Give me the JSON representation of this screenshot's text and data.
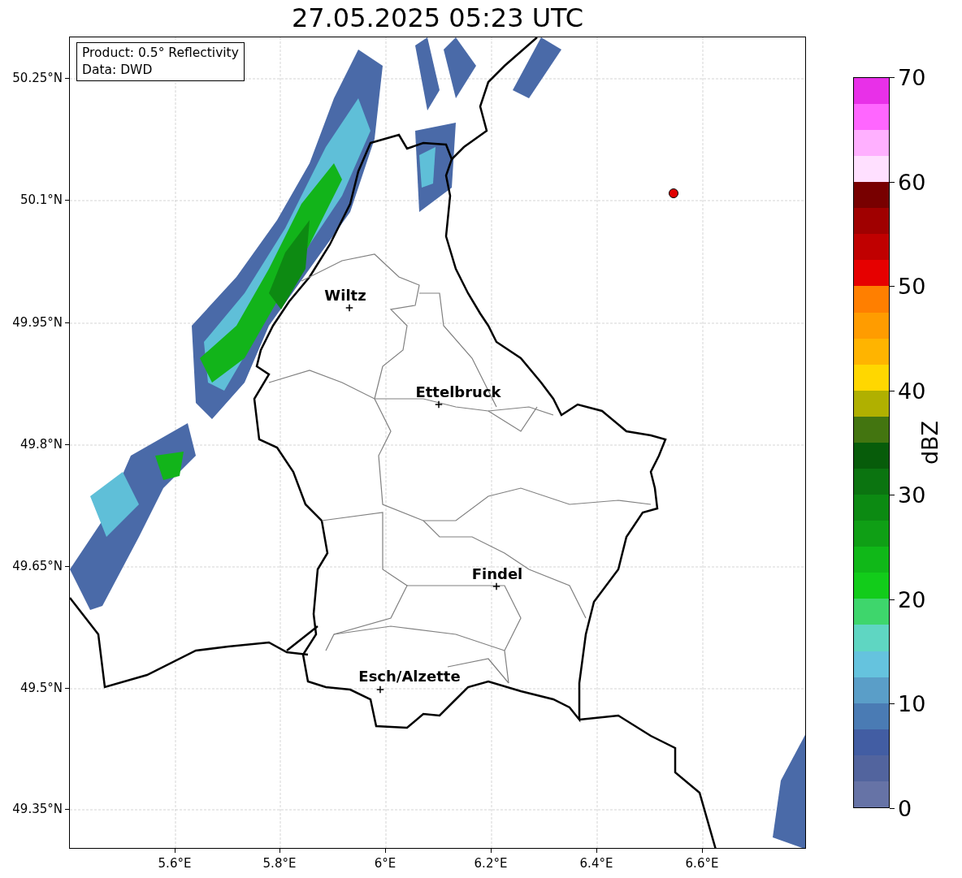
{
  "title": "27.05.2025 05:23 UTC",
  "info_box": [
    "Product: 0.5° Reflectivity",
    "Data: DWD"
  ],
  "y_ticks": [
    "50.25°N",
    "50.1°N",
    "49.95°N",
    "49.8°N",
    "49.65°N",
    "49.5°N",
    "49.35°N"
  ],
  "x_ticks": [
    "5.6°E",
    "5.8°E",
    "6°E",
    "6.2°E",
    "6.4°E",
    "6.6°E"
  ],
  "cities": [
    {
      "name": "Wiltz"
    },
    {
      "name": "Ettelbruck"
    },
    {
      "name": "Findel"
    },
    {
      "name": "Esch/Alzette"
    }
  ],
  "colorbar": {
    "label": "dBZ",
    "ticks": [
      "70",
      "60",
      "50",
      "40",
      "30",
      "20",
      "10",
      "0"
    ],
    "segments": [
      {
        "color": "#6673a6"
      },
      {
        "color": "#52649e"
      },
      {
        "color": "#425da3"
      },
      {
        "color": "#4a7bb4"
      },
      {
        "color": "#5a9ec8"
      },
      {
        "color": "#65c3de"
      },
      {
        "color": "#5fd6c2"
      },
      {
        "color": "#3ed66c"
      },
      {
        "color": "#12cc1a"
      },
      {
        "color": "#10b818"
      },
      {
        "color": "#0f9f15"
      },
      {
        "color": "#0c8a12"
      },
      {
        "color": "#0b7410"
      },
      {
        "color": "#075c0a"
      },
      {
        "color": "#437510"
      },
      {
        "color": "#b0b000"
      },
      {
        "color": "#ffd700"
      },
      {
        "color": "#ffb400"
      },
      {
        "color": "#ff9c00"
      },
      {
        "color": "#ff7f00"
      },
      {
        "color": "#e60000"
      },
      {
        "color": "#c00000"
      },
      {
        "color": "#a00000"
      },
      {
        "color": "#780000"
      },
      {
        "color": "#ffe0ff"
      },
      {
        "color": "#ffb0ff"
      },
      {
        "color": "#ff66ff"
      },
      {
        "color": "#e830e8"
      }
    ]
  }
}
